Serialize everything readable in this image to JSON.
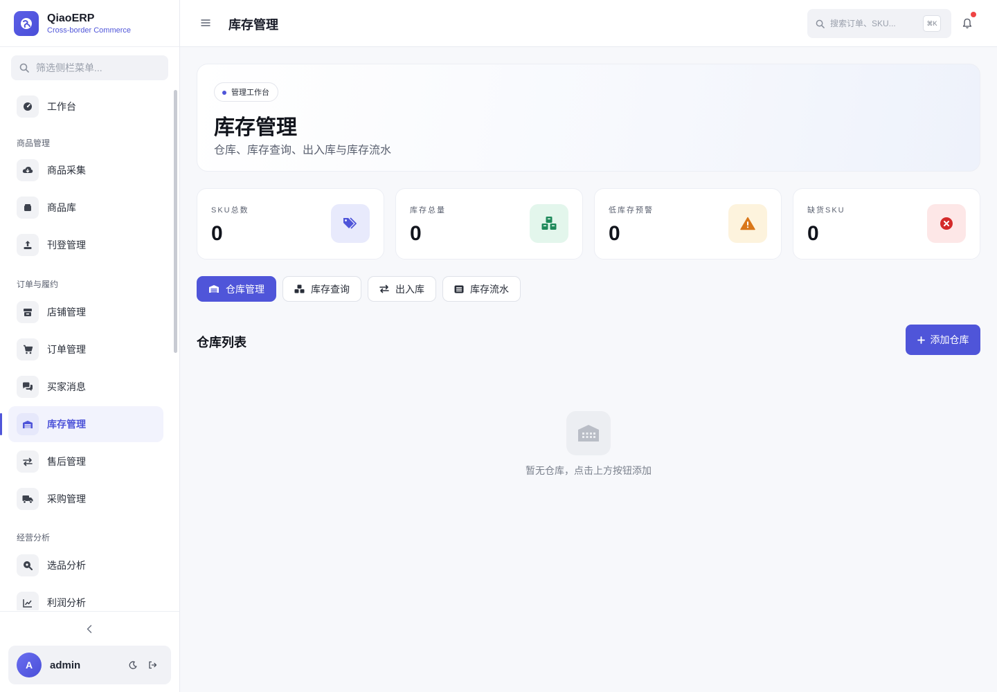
{
  "brand": {
    "name": "QiaoERP",
    "subtitle": "Cross-border Commerce"
  },
  "sidebar": {
    "search_placeholder": "筛选侧栏菜单...",
    "items": [
      {
        "label": "工作台",
        "icon": "gauge-icon"
      },
      {
        "group": "商品管理"
      },
      {
        "label": "商品采集",
        "icon": "cloud-download-icon"
      },
      {
        "label": "商品库",
        "icon": "box-icon"
      },
      {
        "label": "刊登管理",
        "icon": "upload-icon"
      },
      {
        "group": "订单与履约"
      },
      {
        "label": "店铺管理",
        "icon": "store-icon"
      },
      {
        "label": "订单管理",
        "icon": "cart-icon"
      },
      {
        "label": "买家消息",
        "icon": "chat-icon"
      },
      {
        "label": "库存管理",
        "icon": "warehouse-icon",
        "active": true
      },
      {
        "label": "售后管理",
        "icon": "exchange-icon"
      },
      {
        "label": "采购管理",
        "icon": "truck-icon"
      },
      {
        "group": "经营分析"
      },
      {
        "label": "选品分析",
        "icon": "search-dollar-icon"
      },
      {
        "label": "利润分析",
        "icon": "line-chart-icon"
      }
    ]
  },
  "user": {
    "avatar_initial": "A",
    "name": "admin"
  },
  "topbar": {
    "title": "库存管理",
    "search_placeholder": "搜索订单、SKU...",
    "shortcut": "⌘K"
  },
  "hero": {
    "badge": "管理工作台",
    "title": "库存管理",
    "subtitle": "仓库、库存查询、出入库与库存流水"
  },
  "stats": [
    {
      "label": "SKU总数",
      "value": "0",
      "icon": "tags-icon",
      "color": "#4f55d9",
      "bg": "#e8eafc"
    },
    {
      "label": "库存总量",
      "value": "0",
      "icon": "cubes-icon",
      "color": "#1f8a5b",
      "bg": "#e3f6ec"
    },
    {
      "label": "低库存预警",
      "value": "0",
      "icon": "warning-icon",
      "color": "#d9771a",
      "bg": "#fdf3dd"
    },
    {
      "label": "缺货SKU",
      "value": "0",
      "icon": "x-circle-icon",
      "color": "#d42a2a",
      "bg": "#fde7e7"
    }
  ],
  "tabs": [
    {
      "label": "仓库管理",
      "active": true
    },
    {
      "label": "库存查询"
    },
    {
      "label": "出入库"
    },
    {
      "label": "库存流水"
    }
  ],
  "section": {
    "title": "仓库列表",
    "add_button": "添加仓库"
  },
  "empty": {
    "text": "暂无仓库，点击上方按钮添加"
  }
}
